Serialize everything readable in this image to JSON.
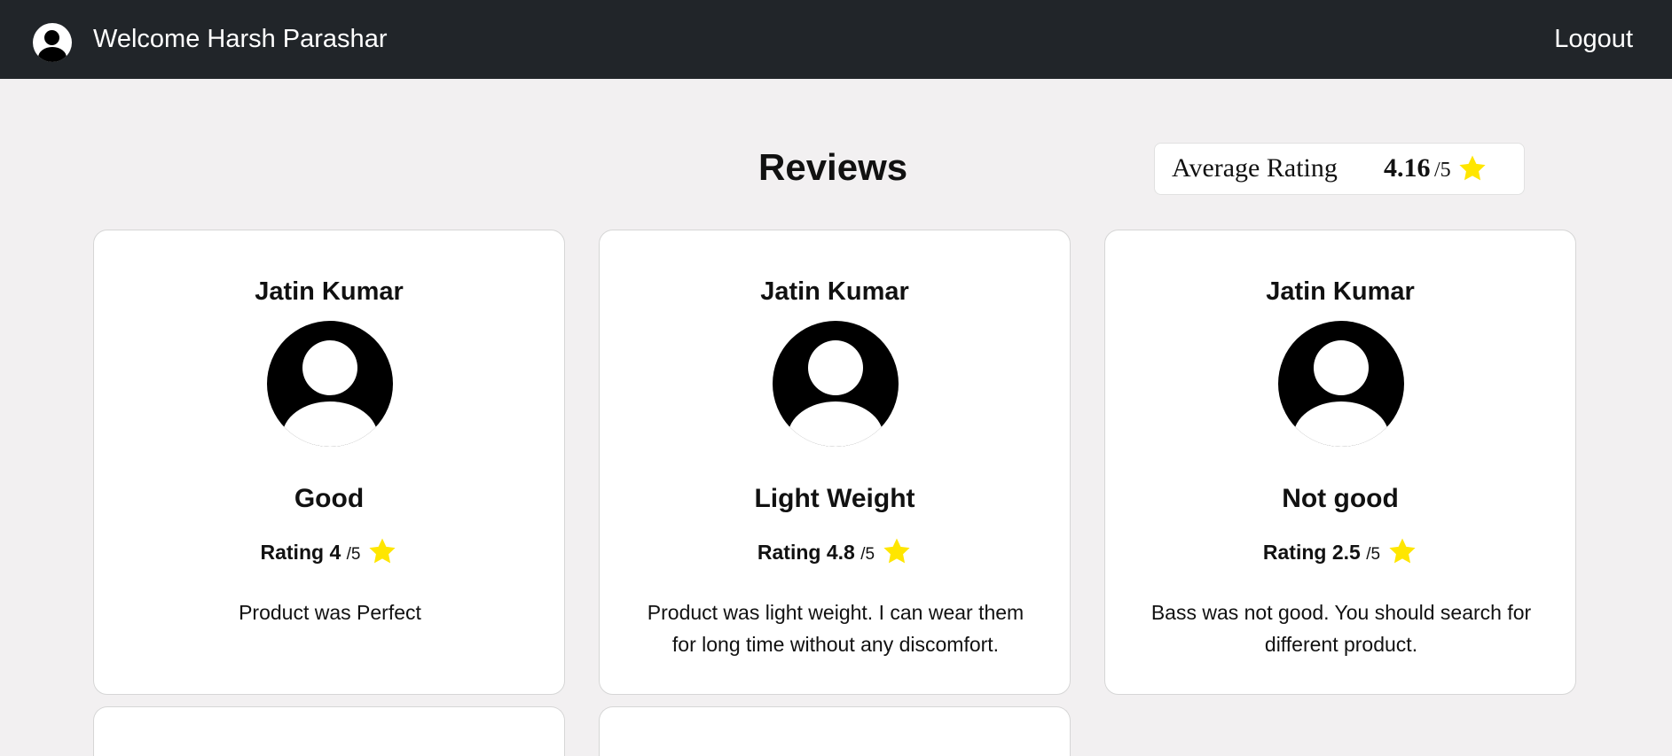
{
  "navbar": {
    "welcome_text": "Welcome Harsh Parashar",
    "logout_label": "Logout",
    "avatar_icon": "user-avatar-icon"
  },
  "page": {
    "title": "Reviews"
  },
  "average": {
    "label": "Average Rating",
    "value": "4.16",
    "scale": "/5",
    "star_color": "#ffe600"
  },
  "reviews": [
    {
      "name": "Jatin Kumar",
      "title": "Good",
      "rating_prefix": "Rating 4 ",
      "rating_scale": "/5",
      "text": "Product was Perfect"
    },
    {
      "name": "Jatin Kumar",
      "title": "Light Weight",
      "rating_prefix": "Rating 4.8 ",
      "rating_scale": "/5",
      "text": "Product was light weight. I can wear them for long time without any discomfort."
    },
    {
      "name": "Jatin Kumar",
      "title": "Not good",
      "rating_prefix": "Rating 2.5 ",
      "rating_scale": "/5",
      "text": "Bass was not good. You should search for different product."
    }
  ],
  "colors": {
    "navbar_bg": "#212529",
    "page_bg": "#f2f0f1",
    "star": "#ffe600"
  }
}
